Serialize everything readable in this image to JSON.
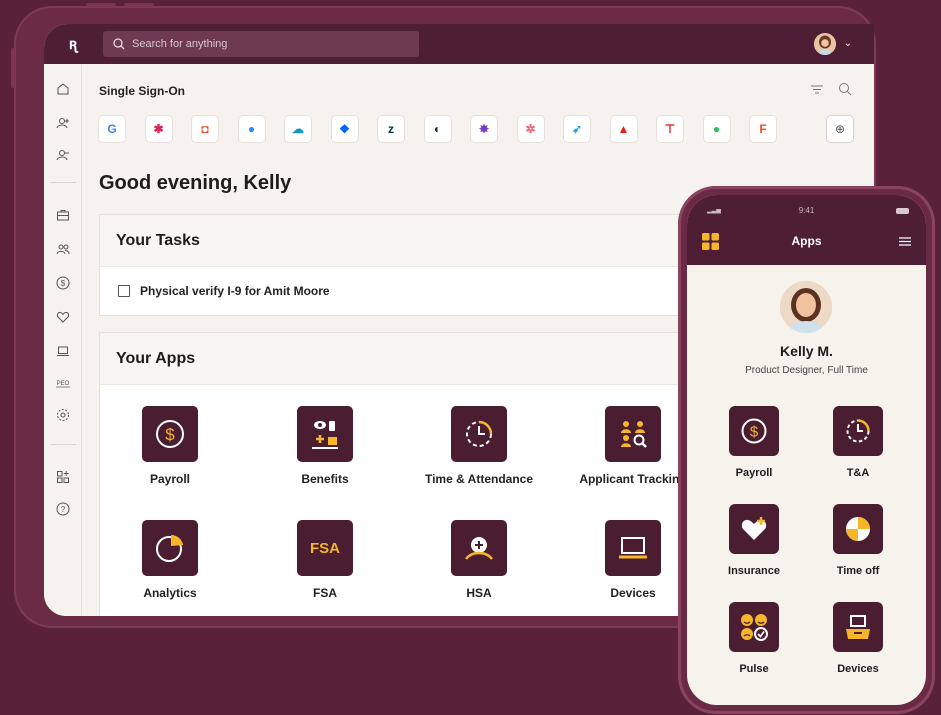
{
  "topbar": {
    "logo": "ꭆ",
    "search_placeholder": "Search for anything"
  },
  "sso": {
    "title": "Single Sign-On",
    "apps": [
      {
        "name": "google",
        "glyph": "G",
        "color": "#4285f4"
      },
      {
        "name": "slack",
        "glyph": "✱",
        "color": "#e01e5a"
      },
      {
        "name": "office",
        "glyph": "◘",
        "color": "#e74c1c"
      },
      {
        "name": "zoom",
        "glyph": "●",
        "color": "#2d8cff"
      },
      {
        "name": "salesforce",
        "glyph": "☁",
        "color": "#1798c1"
      },
      {
        "name": "dropbox",
        "glyph": "❖",
        "color": "#0061ff"
      },
      {
        "name": "zendesk",
        "glyph": "z",
        "color": "#03363d"
      },
      {
        "name": "mailchimp",
        "glyph": "◐",
        "color": "#222222"
      },
      {
        "name": "app-badge",
        "glyph": "✸",
        "color": "#7a3cc5"
      },
      {
        "name": "pinwheel",
        "glyph": "✲",
        "color": "#f2566a"
      },
      {
        "name": "twitter",
        "glyph": "➶",
        "color": "#1da1f2"
      },
      {
        "name": "atlassian",
        "glyph": "▲",
        "color": "#e2231a"
      },
      {
        "name": "target",
        "glyph": "⊤",
        "color": "#e0101a"
      },
      {
        "name": "evernote",
        "glyph": "●",
        "color": "#2dbe60"
      },
      {
        "name": "figma",
        "glyph": "F",
        "color": "#f24e1e"
      }
    ]
  },
  "greeting": "Good evening, Kelly",
  "tasks": {
    "title": "Your Tasks",
    "items": [
      "Physical verify I-9 for Amit Moore"
    ]
  },
  "apps": {
    "title": "Your Apps",
    "items": [
      "Payroll",
      "Benefits",
      "Time & Attendance",
      "Applicant Tracking",
      "Analytics",
      "FSA",
      "HSA",
      "Devices"
    ],
    "fsa_text": "FSA"
  },
  "phone": {
    "time": "9:41",
    "title": "Apps",
    "user_name": "Kelly M.",
    "user_role": "Product Designer, Full Time",
    "apps": [
      "Payroll",
      "T&A",
      "Insurance",
      "Time off",
      "Pulse",
      "Devices"
    ]
  },
  "colors": {
    "accent": "#f5b62a",
    "brand_dark": "#4a1d31",
    "background": "#5a2238"
  }
}
